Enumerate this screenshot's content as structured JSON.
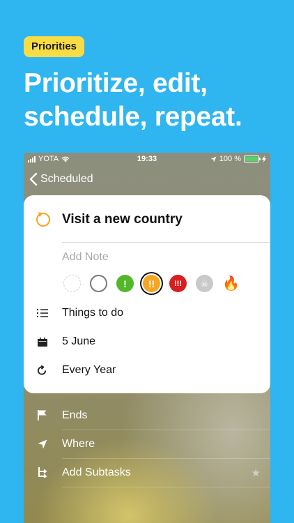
{
  "badge": "Priorities",
  "headline": [
    "Prioritize, edit,",
    "schedule, repeat."
  ],
  "status_bar": {
    "carrier": "YOTA",
    "time": "19:33",
    "battery": "100 %",
    "battery_level": 1.0
  },
  "nav": {
    "back_label": "Scheduled"
  },
  "task": {
    "title": "Visit a new country",
    "note_placeholder": "Add Note",
    "priority_glyphs": {
      "medium": "!",
      "high": "!!",
      "critical": "!!!",
      "skull": "☠",
      "fire": "🔥"
    },
    "priority_selected": "high",
    "list": "Things to do",
    "date": "5 June",
    "repeat": "Every Year"
  },
  "extra_options": {
    "ends": "Ends",
    "where": "Where",
    "subtasks": "Add Subtasks"
  },
  "colors": {
    "background": "#2fb5f0",
    "badge": "#f8dc45",
    "low": "#7a7a7a",
    "medium": "#52b82a",
    "high": "#f5a623",
    "critical": "#d81f1f"
  },
  "icons": [
    "task-repeat-icon",
    "list-icon",
    "calendar-icon",
    "repeat-icon",
    "flag-icon",
    "location-arrow-icon",
    "subtask-icon",
    "star-icon"
  ]
}
